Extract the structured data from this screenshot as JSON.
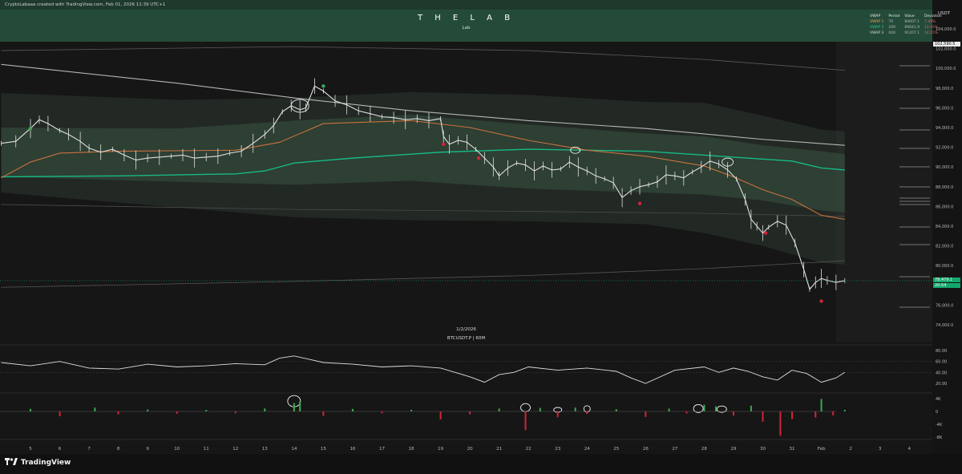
{
  "header": {
    "credit": "CryptoLabaaa created with TradingView.com, Feb 01, 2026 11:39 UTC+1",
    "title": "T H E  L A B",
    "subtitle": "Lab",
    "currency": "USDT"
  },
  "vwap_table": {
    "headers": [
      "VWAP",
      "Period",
      "Value",
      "Deviation"
    ],
    "rows": [
      {
        "name": "VWAP 1",
        "period": "70",
        "value": "84607.1",
        "deviation": "7.49%"
      },
      {
        "name": "VWAP 2",
        "period": "200",
        "value": "89641.9",
        "deviation": "12.43%"
      },
      {
        "name": "VWAP 3",
        "period": "600",
        "value": "91207.1",
        "deviation": "14.15%"
      }
    ]
  },
  "symbol_info": {
    "date": "1/2/2026",
    "symbol": "BTCUSDT.P | 60M"
  },
  "price_labels": {
    "top": "102,590.5",
    "current": "78,479.1",
    "countdown": "20:54"
  },
  "footer": {
    "brand": "TradingView"
  },
  "colors": {
    "background": "#161616",
    "vwap_band": "#2f5f46",
    "vwap_line_green": "#17b886",
    "vwap_line_orange": "#c9713f",
    "long_ma": "#cfcfcf",
    "candle": "#e0e0e0",
    "down_marker": "#d0243a",
    "up_marker": "#3aa856",
    "header_band": "#2c5a43",
    "current_price": "#12a36b"
  },
  "chart_data": [
    {
      "type": "line",
      "name": "price",
      "title": "",
      "xlabel": "",
      "ylabel": "",
      "ylim": [
        72000,
        104000
      ],
      "y_ticks": [
        "104,000.0",
        "102,000.0",
        "100,000.0",
        "98,000.0",
        "96,000.0",
        "94,000.0",
        "92,000.0",
        "90,000.0",
        "88,000.0",
        "86,000.0",
        "84,000.0",
        "82,000.0",
        "80,000.0",
        "78,000.0",
        "76,000.0",
        "74,000.0"
      ],
      "x_ticks": [
        "5",
        "6",
        "7",
        "8",
        "9",
        "10",
        "11",
        "12",
        "13",
        "14",
        "15",
        "16",
        "17",
        "18",
        "19",
        "20",
        "21",
        "22",
        "23",
        "24",
        "25",
        "26",
        "27",
        "28",
        "29",
        "30",
        "31",
        "Feb",
        "2",
        "3",
        "4"
      ],
      "x": [
        4.0,
        4.5,
        5.0,
        5.3,
        5.6,
        6.0,
        6.3,
        6.7,
        7.0,
        7.4,
        7.8,
        8.2,
        8.6,
        9.0,
        9.4,
        9.8,
        10.2,
        10.6,
        11.0,
        11.4,
        11.8,
        12.2,
        12.6,
        13.0,
        13.3,
        13.6,
        13.9,
        14.2,
        14.4,
        14.7,
        15.0,
        15.4,
        15.8,
        16.2,
        16.6,
        17.0,
        17.4,
        17.8,
        18.2,
        18.6,
        19.0,
        19.1,
        19.3,
        19.6,
        19.9,
        20.2,
        20.5,
        20.8,
        21.0,
        21.3,
        21.6,
        21.9,
        22.2,
        22.5,
        22.8,
        23.1,
        23.4,
        23.7,
        24.0,
        24.3,
        24.6,
        24.9,
        25.2,
        25.5,
        25.8,
        26.1,
        26.4,
        26.7,
        27.0,
        27.3,
        27.6,
        27.9,
        28.2,
        28.5,
        28.8,
        29.1,
        29.4,
        29.6,
        29.8,
        30.0,
        30.2,
        30.5,
        30.8,
        31.1,
        31.4,
        31.6,
        31.8,
        32.0,
        32.2,
        32.5,
        32.8
      ],
      "y": [
        92400,
        92600,
        93900,
        94800,
        94400,
        93700,
        93300,
        92600,
        91900,
        91500,
        91800,
        91200,
        90700,
        90900,
        91000,
        91100,
        91200,
        90900,
        91000,
        91100,
        91400,
        91600,
        92400,
        93300,
        94200,
        95600,
        96200,
        95800,
        96000,
        98200,
        97700,
        96700,
        96300,
        95700,
        95400,
        95100,
        95000,
        94800,
        94900,
        94700,
        94900,
        93100,
        92300,
        92700,
        92500,
        91800,
        90900,
        90000,
        89100,
        89900,
        90400,
        90200,
        89600,
        90100,
        89700,
        89800,
        90500,
        90000,
        89600,
        89100,
        88800,
        88400,
        86900,
        87600,
        88000,
        88200,
        88500,
        89200,
        89100,
        88900,
        89500,
        90000,
        90600,
        90300,
        89700,
        88800,
        86700,
        84700,
        84000,
        83300,
        83900,
        84500,
        84100,
        82300,
        79600,
        77600,
        78300,
        78700,
        78500,
        78300,
        78479
      ]
    },
    {
      "type": "line",
      "name": "oscillator",
      "y_ticks": [
        "80.00",
        "60.00",
        "40.00",
        "20.00"
      ],
      "ylim": [
        10,
        85
      ],
      "x": [
        4,
        5,
        6,
        7,
        8,
        9,
        10,
        11,
        12,
        13,
        13.5,
        14,
        15,
        16,
        17,
        18,
        19,
        19.5,
        20,
        20.5,
        21,
        21.5,
        22,
        23,
        24,
        25,
        25.5,
        26,
        27,
        28,
        28.5,
        29,
        29.5,
        30,
        30.5,
        31,
        31.5,
        32,
        32.5,
        32.8
      ],
      "y": [
        58,
        52,
        60,
        48,
        46,
        55,
        50,
        52,
        56,
        54,
        66,
        70,
        58,
        55,
        50,
        52,
        48,
        40,
        32,
        22,
        36,
        40,
        50,
        44,
        48,
        42,
        30,
        20,
        44,
        50,
        40,
        48,
        42,
        32,
        26,
        44,
        38,
        22,
        30,
        40
      ]
    },
    {
      "type": "bar",
      "name": "volume delta",
      "y_ticks": [
        "4K",
        "0",
        "-4K",
        "-8K"
      ],
      "ylim": [
        -9500,
        5000
      ],
      "x": [
        5,
        6,
        7.2,
        8,
        9,
        10,
        11,
        12,
        13,
        14,
        14.2,
        15,
        16,
        17,
        18,
        19,
        20,
        21,
        21.9,
        22.4,
        23,
        23.6,
        24,
        25,
        26,
        26.8,
        27.4,
        28,
        28.4,
        29,
        29.6,
        30,
        30.6,
        31,
        31.8,
        32,
        32.4,
        32.8
      ],
      "y": [
        800,
        -1500,
        1200,
        -900,
        600,
        -700,
        500,
        -600,
        900,
        2600,
        3200,
        -1400,
        800,
        -600,
        500,
        -2500,
        -900,
        900,
        -5800,
        1100,
        -1800,
        1200,
        -800,
        700,
        -1700,
        900,
        -600,
        2100,
        1600,
        -1300,
        1800,
        -3200,
        -7600,
        -2400,
        -1900,
        3900,
        -1200,
        500
      ]
    }
  ]
}
